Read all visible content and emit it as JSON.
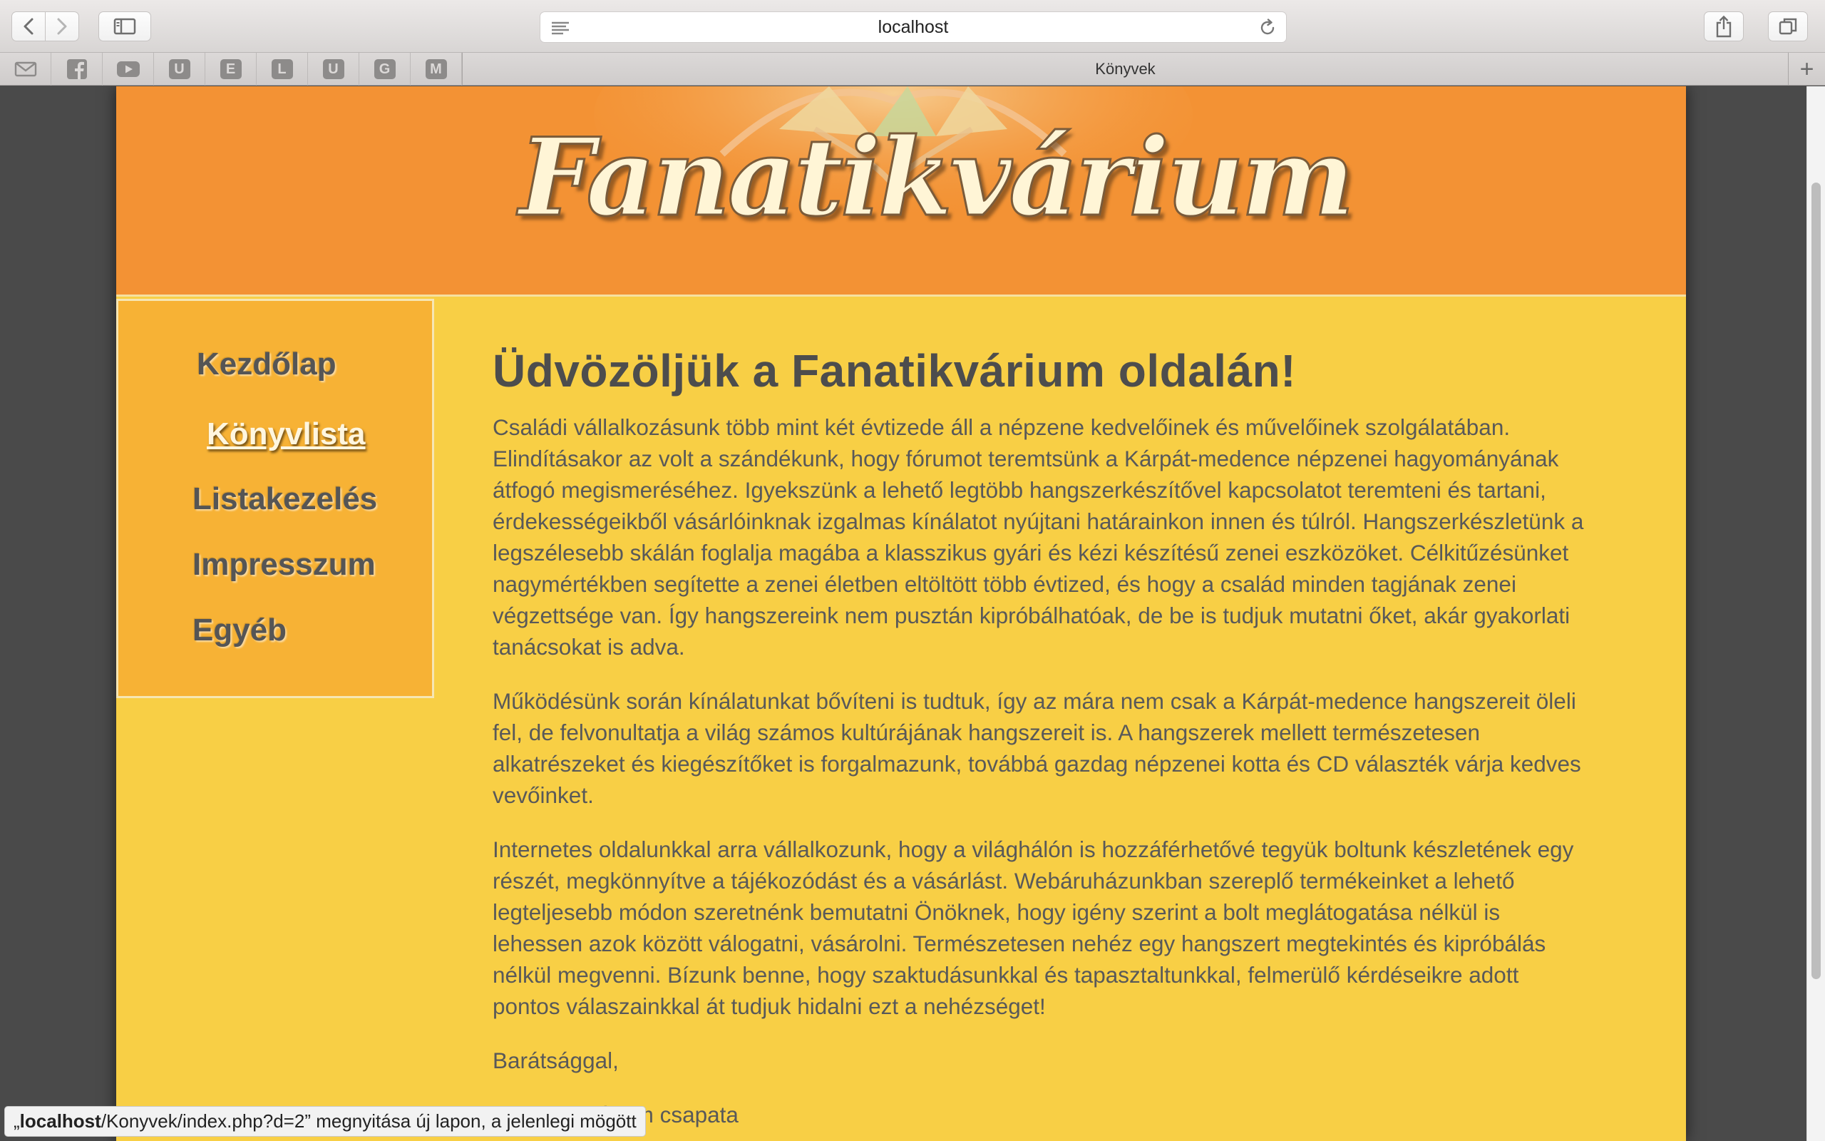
{
  "browser": {
    "address": "localhost",
    "tab_title": "Könyvek",
    "new_tab_label": "+",
    "bookmarks": [
      {
        "icon": "mail-icon"
      },
      {
        "icon": "facebook-icon"
      },
      {
        "icon": "youtube-icon"
      },
      {
        "letter": "U"
      },
      {
        "letter": "E"
      },
      {
        "letter": "L"
      },
      {
        "letter": "U"
      },
      {
        "letter": "G"
      },
      {
        "letter": "M"
      }
    ],
    "status_prefix": "„",
    "status_host": "localhost",
    "status_path": "/Konyvek/index.php?d=2",
    "status_suffix": "” megnyitása új lapon, a jelenlegi mögött"
  },
  "site": {
    "logo_text": "Fanatikvárium",
    "nav": [
      "Kezdőlap",
      "Könyvlista",
      "Listakezelés",
      "Impresszum",
      "Egyéb"
    ],
    "active_nav": "Könyvlista",
    "heading": "Üdvözöljük a Fanatikvárium oldalán!",
    "paragraphs": [
      "Családi vállalkozásunk több mint két évtizede áll a népzene kedvelőinek és művelőinek szolgálatában. Elindításakor az volt a szándékunk, hogy fórumot teremtsünk a Kárpát-medence népzenei hagyományának átfogó megismeréséhez. Igyekszünk a lehető legtöbb hangszerkészítővel kapcsolatot teremteni és tartani, érdekességeikből vásárlóinknak izgalmas kínálatot nyújtani határainkon innen és túlról. Hangszerkészletünk a legszélesebb skálán foglalja magába a klasszikus gyári és kézi készítésű zenei eszközöket. Célkitűzésünket nagymértékben segítette a zenei életben eltöltött több évtized, és hogy a család minden tagjának zenei végzettsége van. Így hangszereink nem pusztán kipróbálhatóak, de be is tudjuk mutatni őket, akár gyakorlati tanácsokat is adva.",
      "Működésünk során kínálatunkat bővíteni is tudtuk, így az mára nem csak a Kárpát-medence hangszereit öleli fel, de felvonultatja a világ számos kultúrájának hangszereit is. A hangszerek mellett természetesen alkatrészeket és kiegészítőket is forgalmazunk, továbbá gazdag népzenei kotta és CD választék várja kedves vevőinket.",
      "Internetes oldalunkkal arra vállalkozunk, hogy a világhálón is hozzáférhetővé tegyük boltunk készletének egy részét, megkönnyítve a tájékozódást és a vásárlást. Webáruházunkban szereplő termékeinket a lehető legteljesebb módon szeretnénk bemutatni Önöknek, hogy igény szerint a bolt meglátogatása nélkül is lehessen azok között válogatni, vásárolni. Természetesen nehéz egy hangszert megtekintés és kipróbálás nélkül megvenni. Bízunk benne, hogy szaktudásunkkal és tapasztaltunkkal, felmerülő kérdéseikre adott pontos válaszainkkal át tudjuk hidalni ezt a nehézséget!",
      "Barátsággal,",
      "A Fanatikvárium csapata"
    ]
  }
}
